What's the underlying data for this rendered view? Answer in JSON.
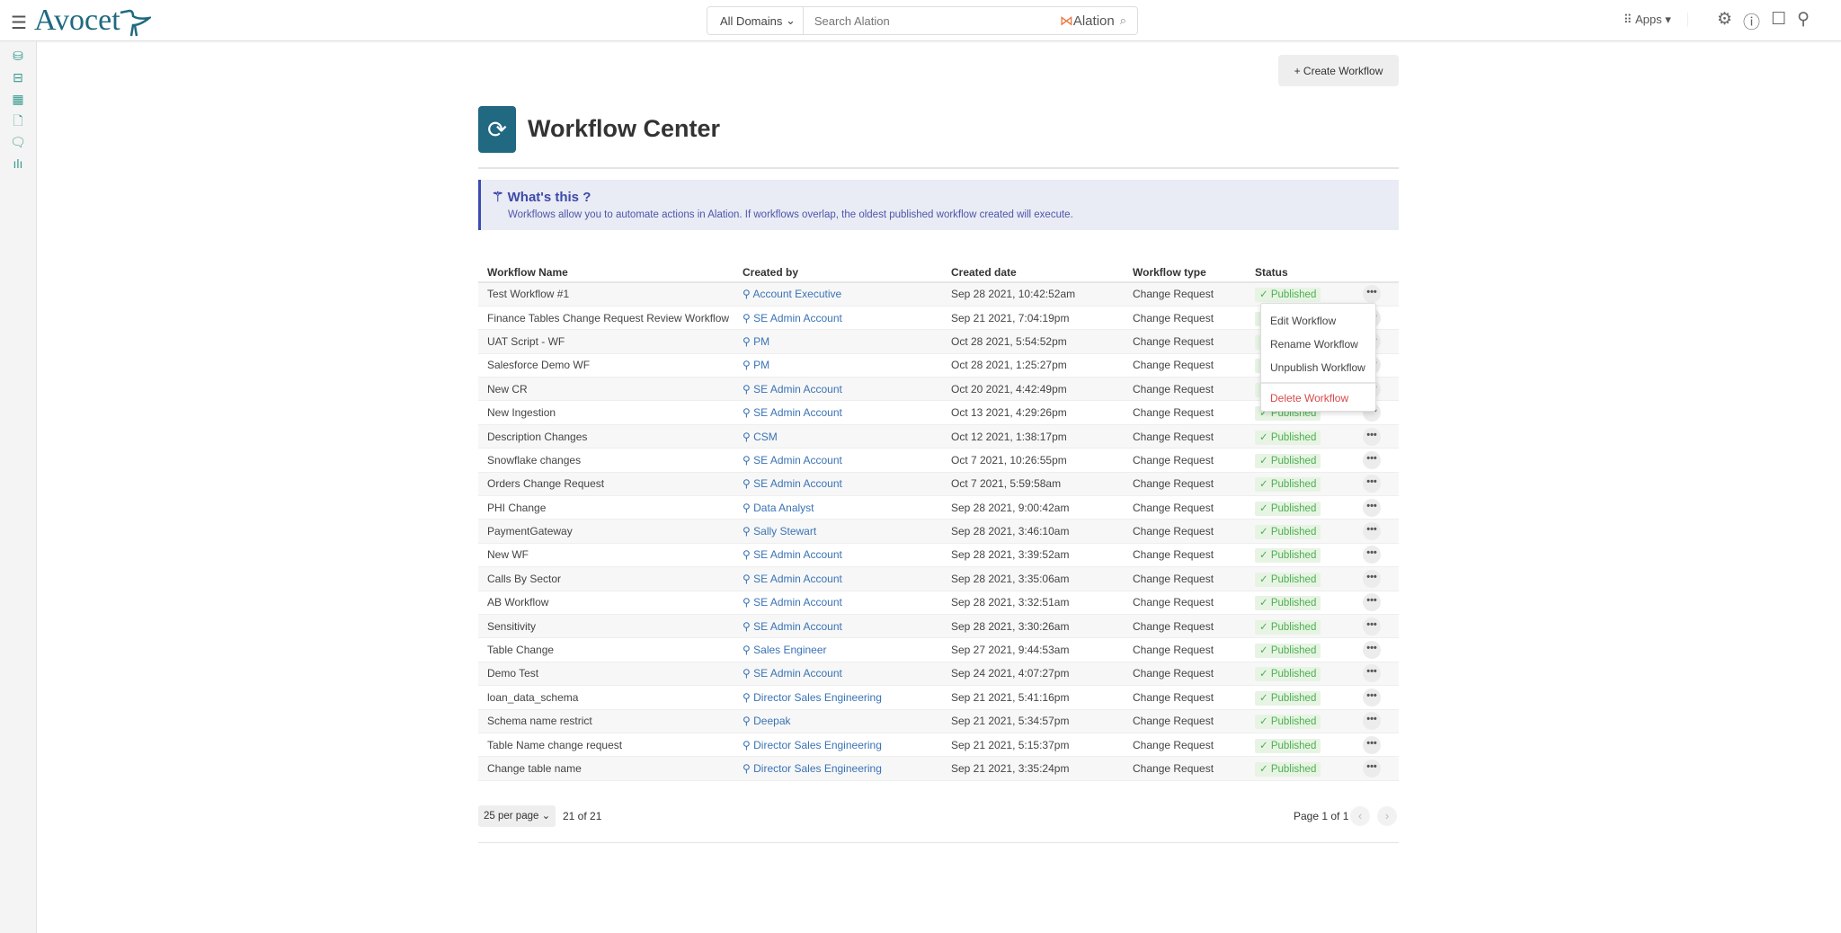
{
  "header": {
    "logo": "Avocet",
    "domain": "All Domains",
    "search_placeholder": "Search Alation",
    "search_brand": "Alation",
    "apps": "Apps"
  },
  "page": {
    "create_label": "Create Workflow",
    "title": "Workflow Center"
  },
  "info": {
    "title": "What's this ?",
    "text": "Workflows allow you to automate actions in Alation. If workflows overlap, the oldest published workflow created will execute."
  },
  "table": {
    "headers": [
      "Workflow Name",
      "Created by",
      "Created date",
      "Workflow type",
      "Status"
    ],
    "rows": [
      [
        "Test Workflow #1",
        "Account Executive",
        "Sep 28 2021, 10:42:52am",
        "Change Request",
        "Published"
      ],
      [
        "Finance Tables Change Request Review Workflow",
        "SE Admin Account",
        "Sep 21 2021, 7:04:19pm",
        "Change Request",
        "Published"
      ],
      [
        "UAT Script - WF",
        "PM",
        "Oct 28 2021, 5:54:52pm",
        "Change Request",
        "Published"
      ],
      [
        "Salesforce Demo WF",
        "PM",
        "Oct 28 2021, 1:25:27pm",
        "Change Request",
        "Published"
      ],
      [
        "New CR",
        "SE Admin Account",
        "Oct 20 2021, 4:42:49pm",
        "Change Request",
        "Published"
      ],
      [
        "New Ingestion",
        "SE Admin Account",
        "Oct 13 2021, 4:29:26pm",
        "Change Request",
        "Published"
      ],
      [
        "Description Changes",
        "CSM",
        "Oct 12 2021, 1:38:17pm",
        "Change Request",
        "Published"
      ],
      [
        "Snowflake changes",
        "SE Admin Account",
        "Oct 7 2021, 10:26:55pm",
        "Change Request",
        "Published"
      ],
      [
        "Orders Change Request",
        "SE Admin Account",
        "Oct 7 2021, 5:59:58am",
        "Change Request",
        "Published"
      ],
      [
        "PHI Change",
        "Data Analyst",
        "Sep 28 2021, 9:00:42am",
        "Change Request",
        "Published"
      ],
      [
        "PaymentGateway",
        "Sally Stewart",
        "Sep 28 2021, 3:46:10am",
        "Change Request",
        "Published"
      ],
      [
        "New WF",
        "SE Admin Account",
        "Sep 28 2021, 3:39:52am",
        "Change Request",
        "Published"
      ],
      [
        "Calls By Sector",
        "SE Admin Account",
        "Sep 28 2021, 3:35:06am",
        "Change Request",
        "Published"
      ],
      [
        "AB Workflow",
        "SE Admin Account",
        "Sep 28 2021, 3:32:51am",
        "Change Request",
        "Published"
      ],
      [
        "Sensitivity",
        "SE Admin Account",
        "Sep 28 2021, 3:30:26am",
        "Change Request",
        "Published"
      ],
      [
        "Table Change",
        "Sales Engineer",
        "Sep 27 2021, 9:44:53am",
        "Change Request",
        "Published"
      ],
      [
        "Demo Test",
        "SE Admin Account",
        "Sep 24 2021, 4:07:27pm",
        "Change Request",
        "Published"
      ],
      [
        "loan_data_schema",
        "Director Sales Engineering",
        "Sep 21 2021, 5:41:16pm",
        "Change Request",
        "Published"
      ],
      [
        "Schema name restrict",
        "Deepak",
        "Sep 21 2021, 5:34:57pm",
        "Change Request",
        "Published"
      ],
      [
        "Table Name change request",
        "Director Sales Engineering",
        "Sep 21 2021, 5:15:37pm",
        "Change Request",
        "Published"
      ],
      [
        "Change table name",
        "Director Sales Engineering",
        "Sep 21 2021, 3:35:24pm",
        "Change Request",
        "Published"
      ]
    ]
  },
  "menu": {
    "edit": "Edit Workflow",
    "rename": "Rename Workflow",
    "unpublish": "Unpublish Workflow",
    "delete": "Delete Workflow"
  },
  "footer": {
    "per_page": "25 per page",
    "count": "21 of 21",
    "page": "Page 1 of 1"
  }
}
